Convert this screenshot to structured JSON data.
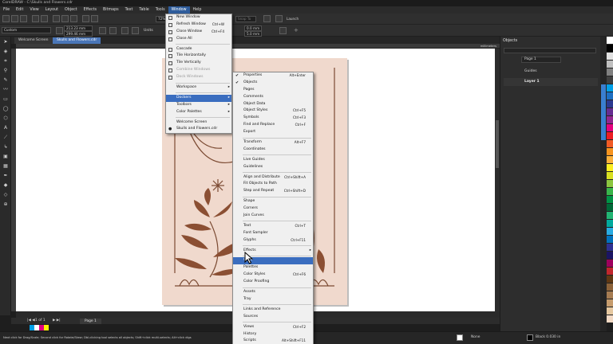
{
  "title": "CorelDRAW - C:\\Skulls and Flowers.cdr",
  "menubar": [
    "File",
    "Edit",
    "View",
    "Layout",
    "Object",
    "Effects",
    "Bitmaps",
    "Text",
    "Table",
    "Tools",
    "Window",
    "Help"
  ],
  "propbar": {
    "preset": "Custom",
    "width": "213.23 mm",
    "height": "299.46 mm",
    "units_label": "Units",
    "zoom": "72%",
    "snap_to": "Snap To",
    "launch": "Launch",
    "nudge1": "0.0 mm",
    "nudge2": "5.0 mm"
  },
  "tabs": [
    "Welcome Screen",
    "Skulls and Flowers.cdr"
  ],
  "ruler_unit": "millimeters",
  "window_menu": [
    {
      "label": "New Window",
      "shortcut": "",
      "state": "normal",
      "icon": true
    },
    {
      "label": "Refresh Window",
      "shortcut": "Ctrl+W",
      "state": "normal",
      "icon": true
    },
    {
      "label": "Close Window",
      "shortcut": "Ctrl+F4",
      "state": "normal",
      "icon": true
    },
    {
      "label": "Close All",
      "shortcut": "",
      "state": "normal",
      "icon": true
    },
    {
      "sep": true
    },
    {
      "label": "Cascade",
      "shortcut": "",
      "state": "normal",
      "icon": true
    },
    {
      "label": "Tile Horizontally",
      "shortcut": "",
      "state": "normal",
      "icon": true
    },
    {
      "label": "Tile Vertically",
      "shortcut": "",
      "state": "normal",
      "icon": true
    },
    {
      "label": "Combine Windows",
      "shortcut": "",
      "state": "disabled",
      "icon": true
    },
    {
      "label": "Dock Windows",
      "shortcut": "",
      "state": "disabled",
      "icon": true
    },
    {
      "sep": true
    },
    {
      "label": "Workspace",
      "shortcut": "",
      "state": "normal",
      "sub": true
    },
    {
      "sep": true
    },
    {
      "label": "Dockers",
      "shortcut": "",
      "state": "highlight",
      "sub": true
    },
    {
      "label": "Toolbars",
      "shortcut": "",
      "state": "normal",
      "sub": true
    },
    {
      "label": "Color Palettes",
      "shortcut": "",
      "state": "normal",
      "sub": true
    },
    {
      "sep": true
    },
    {
      "label": "Welcome Screen",
      "shortcut": "",
      "state": "normal"
    },
    {
      "label": "Skulls and Flowers.cdr",
      "shortcut": "",
      "state": "normal",
      "dot": true
    }
  ],
  "dockers_menu": [
    {
      "label": "Properties",
      "shortcut": "Alt+Enter",
      "checked": true
    },
    {
      "label": "Objects",
      "shortcut": "",
      "checked": true
    },
    {
      "label": "Pages",
      "shortcut": ""
    },
    {
      "label": "Comments",
      "shortcut": ""
    },
    {
      "label": "Object Data",
      "shortcut": ""
    },
    {
      "label": "Object Styles",
      "shortcut": "Ctrl+F5"
    },
    {
      "label": "Symbols",
      "shortcut": "Ctrl+F3"
    },
    {
      "label": "Find and Replace",
      "shortcut": "Ctrl+F"
    },
    {
      "label": "Export",
      "shortcut": ""
    },
    {
      "sep": true
    },
    {
      "label": "Transform",
      "shortcut": "Alt+F7"
    },
    {
      "label": "Coordinates",
      "shortcut": ""
    },
    {
      "sep": true
    },
    {
      "label": "Live Guides",
      "shortcut": ""
    },
    {
      "label": "Guidelines",
      "shortcut": ""
    },
    {
      "sep": true
    },
    {
      "label": "Align and Distribute",
      "shortcut": "Ctrl+Shift+A"
    },
    {
      "label": "Fit Objects to Path",
      "shortcut": ""
    },
    {
      "label": "Step and Repeat",
      "shortcut": "Ctrl+Shift+D"
    },
    {
      "sep": true
    },
    {
      "label": "Shape",
      "shortcut": ""
    },
    {
      "label": "Corners",
      "shortcut": ""
    },
    {
      "label": "Join Curves",
      "shortcut": ""
    },
    {
      "sep": true
    },
    {
      "label": "Text",
      "shortcut": "Ctrl+T"
    },
    {
      "label": "Font Sampler",
      "shortcut": ""
    },
    {
      "label": "Glyphs",
      "shortcut": "Ctrl+F11"
    },
    {
      "sep": true
    },
    {
      "label": "Effects",
      "shortcut": "",
      "sub": true
    },
    {
      "sep": true
    },
    {
      "label": "Color",
      "shortcut": "",
      "highlight": true
    },
    {
      "label": "Palettes",
      "shortcut": ""
    },
    {
      "label": "Color Styles",
      "shortcut": "Ctrl+F6"
    },
    {
      "label": "Color Proofing",
      "shortcut": ""
    },
    {
      "sep": true
    },
    {
      "label": "Assets",
      "shortcut": ""
    },
    {
      "label": "Tray",
      "shortcut": ""
    },
    {
      "sep": true
    },
    {
      "label": "Links and Reference",
      "shortcut": ""
    },
    {
      "label": "Sources",
      "shortcut": ""
    },
    {
      "sep": true
    },
    {
      "label": "Views",
      "shortcut": "Ctrl+F2"
    },
    {
      "label": "History",
      "shortcut": ""
    },
    {
      "label": "Scripts",
      "shortcut": "Alt+Shift+F11"
    },
    {
      "sep": true
    },
    {
      "label": "Learn",
      "shortcut": ""
    }
  ],
  "objects_docker": {
    "title": "Objects",
    "page_select": "Page 1",
    "guides": "Guides",
    "layer": "Layer 1"
  },
  "pagebar": {
    "page_of": "1 of 1",
    "page_tab": "Page 1"
  },
  "status": {
    "hint": "Next click for Drag/Scale; Second click for Rotate/Skew; Dbl-clicking tool selects all objects; Shift+click multi-selects; Alt+click digs",
    "fill": "None",
    "outline": "Black 0.030 in"
  },
  "colors": {
    "accent": "#3a6dbf",
    "paper": "#f0d9cd",
    "art": "#7b4a32",
    "palette": [
      "#ffffff",
      "#000000",
      "#00a0e8",
      "#e4007f",
      "#fff100",
      "#2ea7e0",
      "#ff0000"
    ]
  }
}
